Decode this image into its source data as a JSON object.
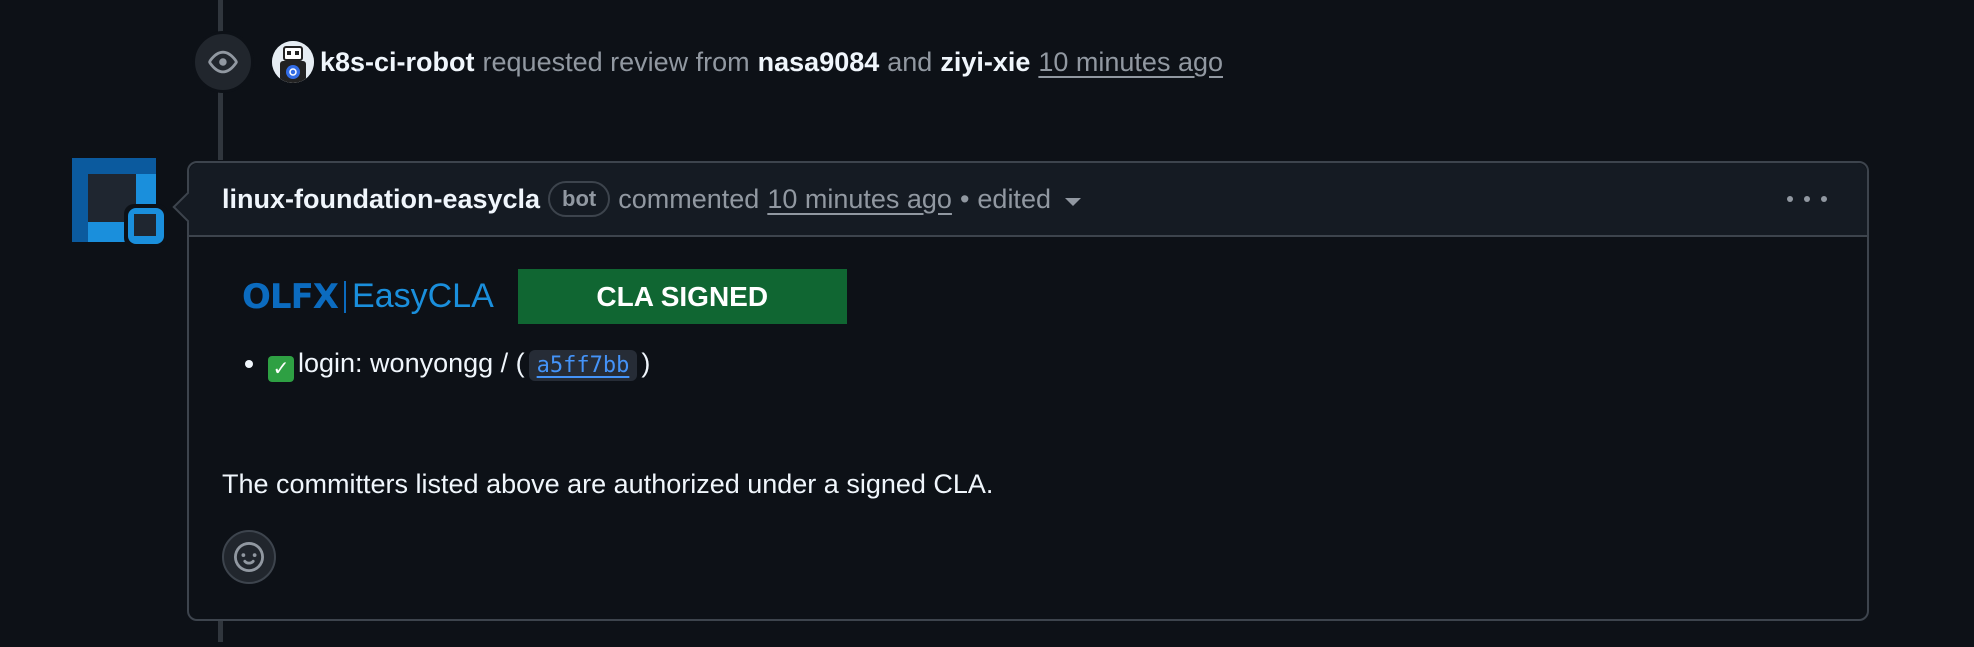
{
  "event": {
    "actor": "k8s-ci-robot",
    "action_text": "requested review from",
    "reviewer1": "nasa9084",
    "conjunction": "and",
    "reviewer2": "ziyi-xie",
    "time": "10 minutes ago",
    "icon": "eye-icon"
  },
  "comment": {
    "author": "linux-foundation-easycla",
    "bot_label": "bot",
    "action": "commented",
    "time": "10 minutes ago",
    "separator": "•",
    "edited_label": "edited",
    "body": {
      "lfx_mark": "OLFX",
      "logo_name": "EasyCLA",
      "badge_label": "CLA SIGNED",
      "login_prefix": "login: wonyongg / (",
      "commit": "a5ff7bb",
      "login_suffix": ")",
      "footer": "The committers listed above are authorized under a signed CLA."
    }
  },
  "colors": {
    "background": "#0d1117",
    "badge_green": "#106632",
    "link_blue": "#4493f8",
    "lfx_blue": "#0b6bbf"
  }
}
